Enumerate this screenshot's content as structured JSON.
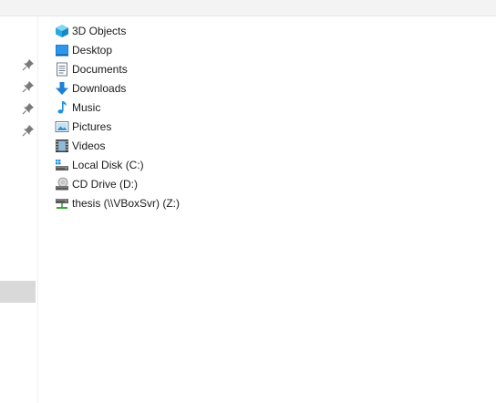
{
  "explorer": {
    "items": [
      {
        "label": "3D Objects",
        "icon": "3d-objects-icon"
      },
      {
        "label": "Desktop",
        "icon": "desktop-icon"
      },
      {
        "label": "Documents",
        "icon": "documents-icon"
      },
      {
        "label": "Downloads",
        "icon": "downloads-icon"
      },
      {
        "label": "Music",
        "icon": "music-icon"
      },
      {
        "label": "Pictures",
        "icon": "pictures-icon"
      },
      {
        "label": "Videos",
        "icon": "videos-icon"
      },
      {
        "label": "Local Disk (C:)",
        "icon": "local-disk-icon"
      },
      {
        "label": "CD Drive (D:)",
        "icon": "cd-drive-icon"
      },
      {
        "label": "thesis (\\\\VBoxSvr) (Z:)",
        "icon": "network-drive-icon"
      }
    ]
  },
  "colors": {
    "accent": "#1e90e0",
    "selection": "#d9d9d9",
    "toolbar_bg": "#f3f3f3"
  }
}
